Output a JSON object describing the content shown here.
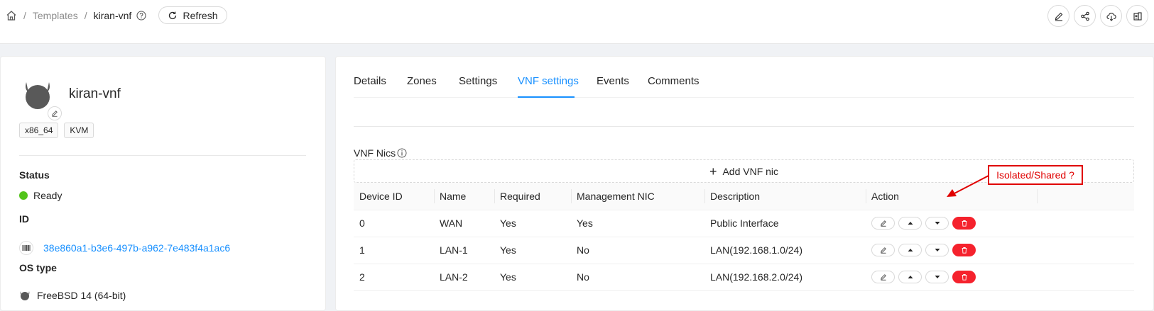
{
  "breadcrumb": {
    "root_icon": "home-icon",
    "templates": "Templates",
    "current": "kiran-vnf"
  },
  "toolbar": {
    "refresh_label": "Refresh",
    "actions": [
      "edit-icon",
      "share-icon",
      "cloud-download-icon",
      "copy-icon"
    ]
  },
  "vm": {
    "name": "kiran-vnf",
    "tags": [
      "x86_64",
      "KVM"
    ],
    "status_label": "Status",
    "status_value": "Ready",
    "id_label": "ID",
    "id_value": "38e860a1-b3e6-497b-a962-7e483f4a1ac6",
    "os_label": "OS type",
    "os_value": "FreeBSD 14 (64-bit)"
  },
  "tabs": [
    "Details",
    "Zones",
    "Settings",
    "VNF settings",
    "Events",
    "Comments"
  ],
  "active_tab": "VNF settings",
  "vnf": {
    "title": "VNF Nics",
    "add_label": "Add VNF nic",
    "columns": [
      "Device ID",
      "Name",
      "Required",
      "Management NIC",
      "Description",
      "Action"
    ],
    "rows": [
      {
        "device_id": "0",
        "name": "WAN",
        "required": "Yes",
        "management": "Yes",
        "description": "Public Interface"
      },
      {
        "device_id": "1",
        "name": "LAN-1",
        "required": "Yes",
        "management": "No",
        "description": "LAN(192.168.1.0/24)"
      },
      {
        "device_id": "2",
        "name": "LAN-2",
        "required": "Yes",
        "management": "No",
        "description": "LAN(192.168.2.0/24)"
      }
    ]
  },
  "annotation": {
    "text": "Isolated/Shared ?"
  },
  "colors": {
    "accent": "#1890ff",
    "danger": "#f5222d",
    "ready": "#52c41a",
    "annotation": "#e00000"
  }
}
